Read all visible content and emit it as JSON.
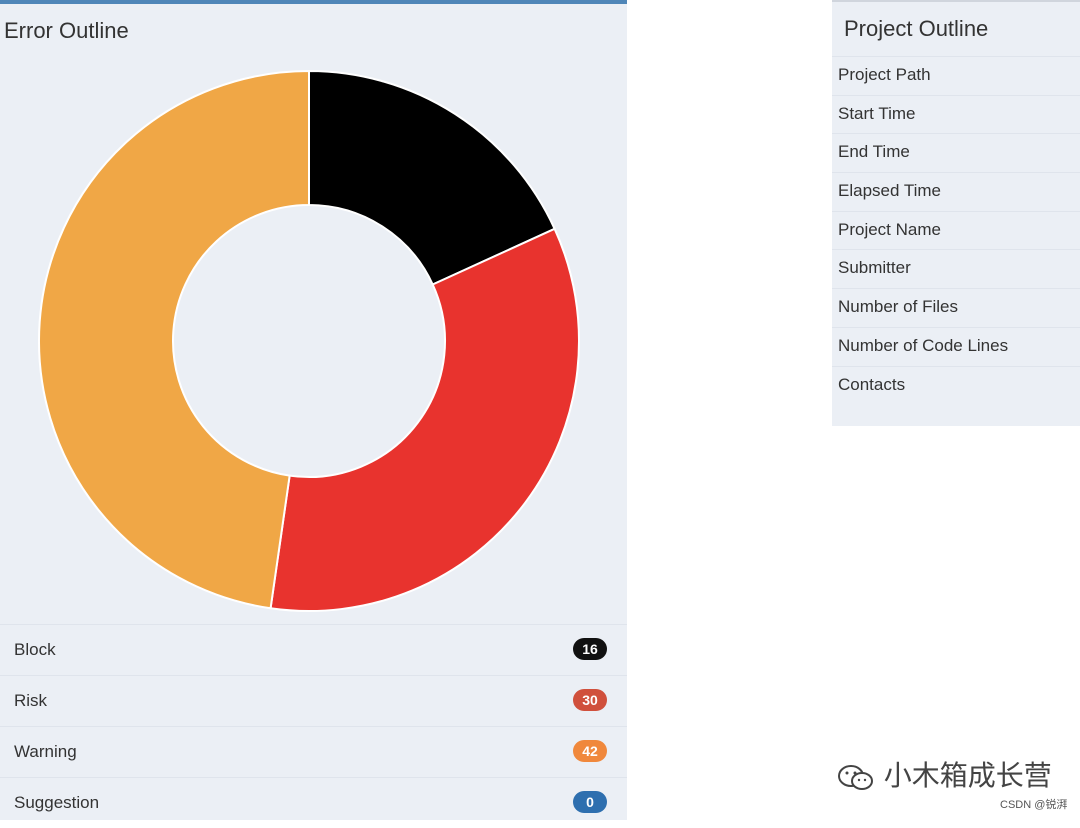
{
  "error_outline": {
    "title": "Error Outline",
    "legend": [
      {
        "label": "Block",
        "count": "16",
        "color": "#111111"
      },
      {
        "label": "Risk",
        "count": "30",
        "color": "#d0503c"
      },
      {
        "label": "Warning",
        "count": "42",
        "color": "#f0883c"
      },
      {
        "label": "Suggestion",
        "count": "0",
        "color": "#2e6faf"
      }
    ]
  },
  "chart_data": {
    "type": "pie",
    "categories": [
      "Block",
      "Risk",
      "Warning",
      "Suggestion"
    ],
    "values": [
      16,
      30,
      42,
      0
    ],
    "colors": [
      "#000000",
      "#e8332e",
      "#f0a746",
      "#2e6faf"
    ],
    "donut": true
  },
  "project_outline": {
    "title": "Project Outline",
    "items": [
      "Project Path",
      "Start Time",
      "End Time",
      "Elapsed Time",
      "Project Name",
      "Submitter",
      "Number of Files",
      "Number of Code Lines",
      "Contacts"
    ]
  },
  "watermark": {
    "text": "小木箱成长营",
    "icon": "wechat-icon",
    "source": "CSDN @锐湃"
  }
}
